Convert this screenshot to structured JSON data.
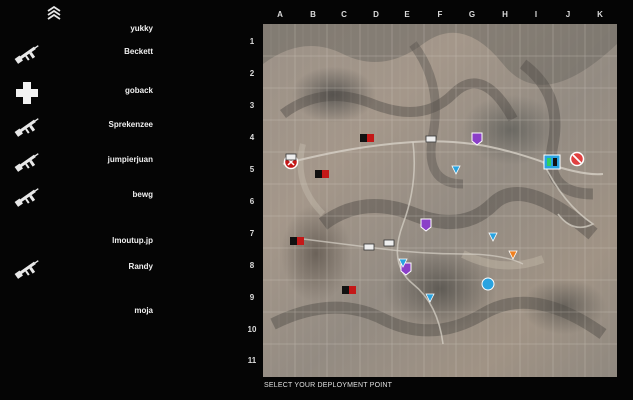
{
  "roster": [
    {
      "name": "yukky",
      "weapon": ""
    },
    {
      "name": "Beckett",
      "weapon": "rifle-icon"
    },
    {
      "name": "goback",
      "weapon": "medic-cross-icon"
    },
    {
      "name": "Sprekenzee",
      "weapon": "rifle-icon"
    },
    {
      "name": "jumpierjuan",
      "weapon": "rifle-icon"
    },
    {
      "name": "bewg",
      "weapon": "rifle-icon"
    },
    {
      "name": "lmoutup.jp",
      "weapon": ""
    },
    {
      "name": "Randy",
      "weapon": "rifle-icon"
    },
    {
      "name": "moja",
      "weapon": ""
    }
  ],
  "map": {
    "columns": [
      "A",
      "B",
      "C",
      "D",
      "E",
      "F",
      "G",
      "H",
      "I",
      "J",
      "K"
    ],
    "rows": [
      "1",
      "2",
      "3",
      "4",
      "5",
      "6",
      "7",
      "8",
      "9",
      "10",
      "11"
    ],
    "footer": "SELECT YOUR DEPLOYMENT POINT"
  },
  "colors": {
    "background": "#050505",
    "friendly": "#29a3e0",
    "objective": "#8b3fc8",
    "enemy_flag": "#c41818",
    "hq": "#e0e0e0",
    "grid": "#d8d2c8"
  }
}
